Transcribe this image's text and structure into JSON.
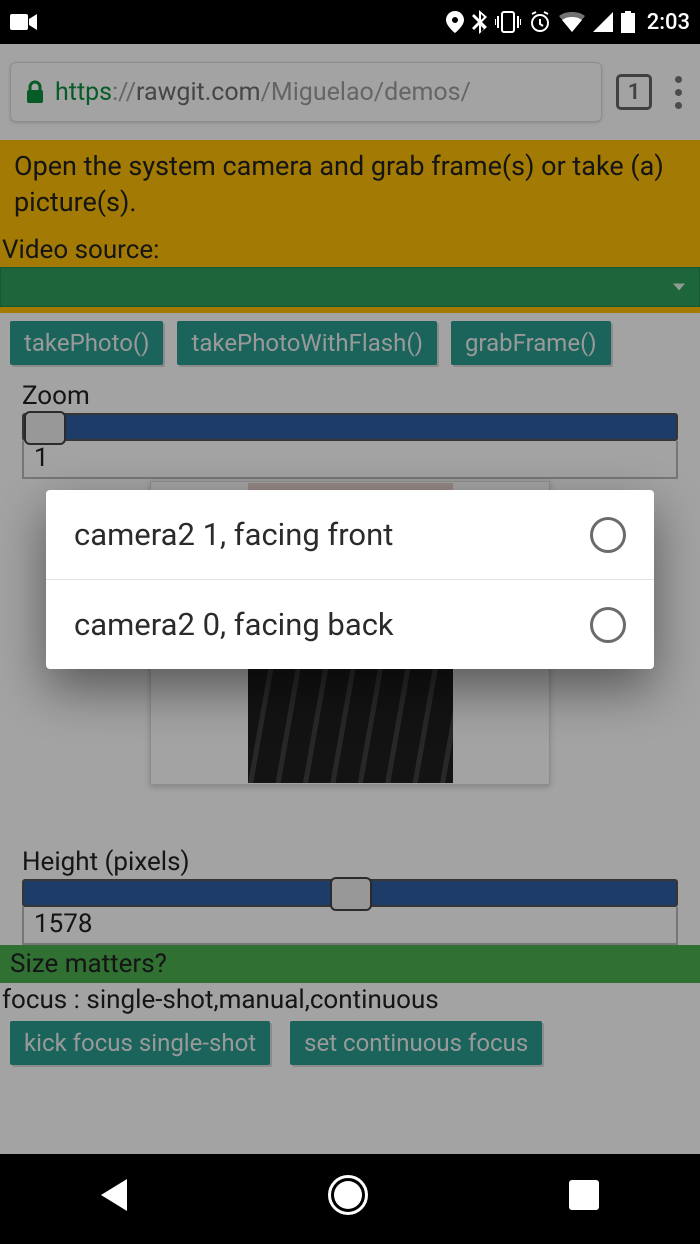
{
  "status": {
    "time": "2:03"
  },
  "browser": {
    "url_scheme": "https",
    "url_host": "rawgit.com",
    "url_path": "/Miguelao/demos/",
    "tab_count": "1"
  },
  "page": {
    "banner": "Open the system camera and grab frame(s) or take (a) picture(s).",
    "video_source_label": "Video source:",
    "buttons": {
      "takePhoto": "takePhoto()",
      "takePhotoWithFlash": "takePhotoWithFlash()",
      "grabFrame": "grabFrame()"
    },
    "zoom": {
      "label": "Zoom",
      "value": "1"
    },
    "height": {
      "label": "Height (pixels)",
      "value": "1578"
    },
    "size_matters": "Size matters?",
    "focus_line": "focus : single-shot,manual,continuous",
    "buttons2": {
      "kickFocus": "kick focus single-shot",
      "setContinuous": "set continuous focus"
    }
  },
  "modal": {
    "options": [
      "camera2 1, facing front",
      "camera2 0, facing back"
    ]
  }
}
